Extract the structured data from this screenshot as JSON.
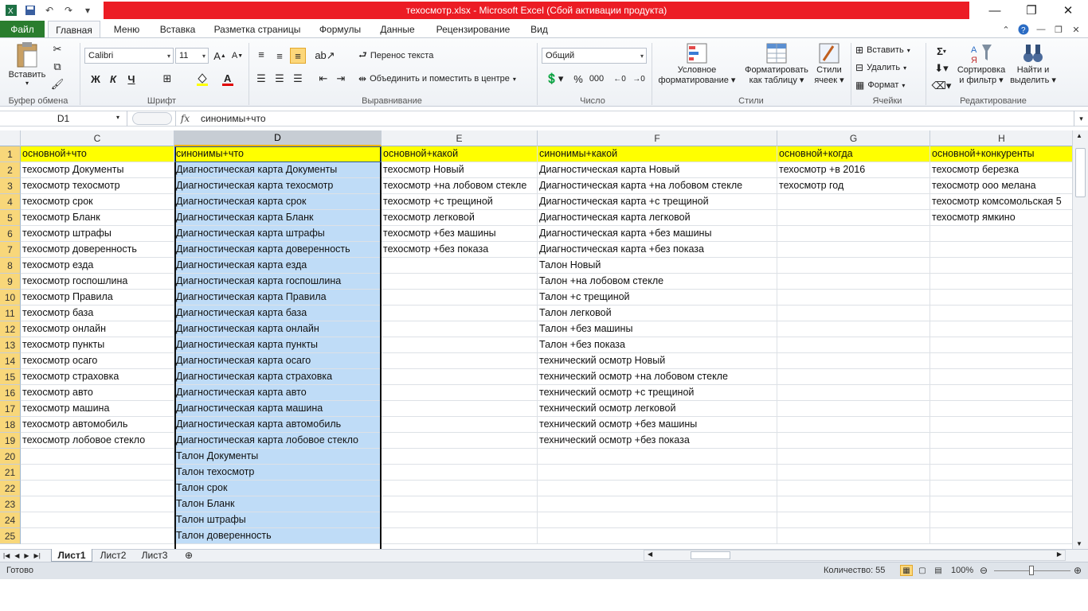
{
  "window": {
    "title": "техосмотр.xlsx  -  Microsoft Excel (Сбой активации продукта)",
    "app_icon": "excel-icon"
  },
  "tabs": {
    "file": "Файл",
    "items": [
      "Главная",
      "Меню",
      "Вставка",
      "Разметка страницы",
      "Формулы",
      "Данные",
      "Рецензирование",
      "Вид"
    ],
    "active": "Главная"
  },
  "ribbon": {
    "clipboard": {
      "paste": "Вставить",
      "label": "Буфер обмена"
    },
    "font": {
      "name": "Calibri",
      "size": "11",
      "label": "Шрифт",
      "bold": "Ж",
      "italic": "К",
      "underline": "Ч"
    },
    "alignment": {
      "wrap": "Перенос текста",
      "merge": "Объединить и поместить в центре",
      "label": "Выравнивание"
    },
    "number": {
      "format": "Общий",
      "label": "Число",
      "percent": "%",
      "thousands": "000"
    },
    "styles": {
      "conditional": "Условное",
      "conditional2": "форматирование",
      "format_table": "Форматировать",
      "format_table2": "как таблицу",
      "cell_styles": "Стили",
      "cell_styles2": "ячеек",
      "label": "Стили"
    },
    "cells": {
      "insert": "Вставить",
      "delete": "Удалить",
      "format": "Формат",
      "label": "Ячейки"
    },
    "editing": {
      "sigma": "Σ",
      "sort": "Сортировка",
      "sort2": "и фильтр",
      "find": "Найти и",
      "find2": "выделить",
      "label": "Редактирование"
    }
  },
  "formula_bar": {
    "name_box": "D1",
    "fx": "fx",
    "content": "синонимы+что"
  },
  "columns": [
    "C",
    "D",
    "E",
    "F",
    "G",
    "H"
  ],
  "selected_column": "D",
  "rows": [
    {
      "n": "1",
      "C": "основной+что",
      "D": "синонимы+что",
      "E": "основной+какой",
      "F": "синонимы+какой",
      "G": "основной+когда",
      "H": "основной+конкуренты"
    },
    {
      "n": "2",
      "C": "техосмотр Документы",
      "D": "Диагностическая карта Документы",
      "E": "техосмотр Новый",
      "F": "Диагностическая карта Новый",
      "G": "техосмотр +в 2016",
      "H": "техосмотр березка"
    },
    {
      "n": "3",
      "C": "техосмотр техосмотр",
      "D": "Диагностическая карта техосмотр",
      "E": "техосмотр +на лобовом стекле",
      "F": "Диагностическая карта +на лобовом стекле",
      "G": "техосмотр год",
      "H": "техосмотр ооо мелана"
    },
    {
      "n": "4",
      "C": "техосмотр срок",
      "D": "Диагностическая карта срок",
      "E": "техосмотр +с трещиной",
      "F": "Диагностическая карта +с трещиной",
      "G": "",
      "H": "техосмотр комсомольская 5"
    },
    {
      "n": "5",
      "C": "техосмотр Бланк",
      "D": "Диагностическая карта Бланк",
      "E": "техосмотр легковой",
      "F": "Диагностическая карта легковой",
      "G": "",
      "H": "техосмотр ямкино"
    },
    {
      "n": "6",
      "C": "техосмотр штрафы",
      "D": "Диагностическая карта штрафы",
      "E": "техосмотр +без машины",
      "F": "Диагностическая карта +без машины",
      "G": "",
      "H": ""
    },
    {
      "n": "7",
      "C": "техосмотр доверенность",
      "D": "Диагностическая карта доверенность",
      "E": "техосмотр +без показа",
      "F": "Диагностическая карта +без показа",
      "G": "",
      "H": ""
    },
    {
      "n": "8",
      "C": "техосмотр езда",
      "D": "Диагностическая карта езда",
      "E": "",
      "F": "Талон Новый",
      "G": "",
      "H": ""
    },
    {
      "n": "9",
      "C": "техосмотр госпошлина",
      "D": "Диагностическая карта госпошлина",
      "E": "",
      "F": "Талон +на лобовом стекле",
      "G": "",
      "H": ""
    },
    {
      "n": "10",
      "C": "техосмотр Правила",
      "D": "Диагностическая карта Правила",
      "E": "",
      "F": "Талон +с трещиной",
      "G": "",
      "H": ""
    },
    {
      "n": "11",
      "C": "техосмотр база",
      "D": "Диагностическая карта база",
      "E": "",
      "F": "Талон легковой",
      "G": "",
      "H": ""
    },
    {
      "n": "12",
      "C": "техосмотр онлайн",
      "D": "Диагностическая карта онлайн",
      "E": "",
      "F": "Талон +без машины",
      "G": "",
      "H": ""
    },
    {
      "n": "13",
      "C": "техосмотр пункты",
      "D": "Диагностическая карта пункты",
      "E": "",
      "F": "Талон +без показа",
      "G": "",
      "H": ""
    },
    {
      "n": "14",
      "C": "техосмотр осаго",
      "D": "Диагностическая карта осаго",
      "E": "",
      "F": "технический осмотр Новый",
      "G": "",
      "H": ""
    },
    {
      "n": "15",
      "C": "техосмотр страховка",
      "D": "Диагностическая карта страховка",
      "E": "",
      "F": "технический осмотр +на лобовом стекле",
      "G": "",
      "H": ""
    },
    {
      "n": "16",
      "C": "техосмотр авто",
      "D": "Диагностическая карта авто",
      "E": "",
      "F": "технический осмотр +с трещиной",
      "G": "",
      "H": ""
    },
    {
      "n": "17",
      "C": "техосмотр машина",
      "D": "Диагностическая карта машина",
      "E": "",
      "F": "технический осмотр легковой",
      "G": "",
      "H": ""
    },
    {
      "n": "18",
      "C": "техосмотр автомобиль",
      "D": "Диагностическая карта автомобиль",
      "E": "",
      "F": "технический осмотр +без машины",
      "G": "",
      "H": ""
    },
    {
      "n": "19",
      "C": "техосмотр лобовое стекло",
      "D": "Диагностическая карта лобовое стекло",
      "E": "",
      "F": "технический осмотр +без показа",
      "G": "",
      "H": ""
    },
    {
      "n": "20",
      "C": "",
      "D": "Талон Документы",
      "E": "",
      "F": "",
      "G": "",
      "H": ""
    },
    {
      "n": "21",
      "C": "",
      "D": "Талон техосмотр",
      "E": "",
      "F": "",
      "G": "",
      "H": ""
    },
    {
      "n": "22",
      "C": "",
      "D": "Талон срок",
      "E": "",
      "F": "",
      "G": "",
      "H": ""
    },
    {
      "n": "23",
      "C": "",
      "D": "Талон Бланк",
      "E": "",
      "F": "",
      "G": "",
      "H": ""
    },
    {
      "n": "24",
      "C": "",
      "D": "Талон штрафы",
      "E": "",
      "F": "",
      "G": "",
      "H": ""
    },
    {
      "n": "25",
      "C": "",
      "D": "Талон доверенность",
      "E": "",
      "F": "",
      "G": "",
      "H": ""
    }
  ],
  "sheets": [
    "Лист1",
    "Лист2",
    "Лист3"
  ],
  "active_sheet": "Лист1",
  "status": {
    "ready": "Готово",
    "count": "Количество: 55",
    "zoom": "100%"
  },
  "colors": {
    "header_yellow": "#ffff00",
    "selection": "#bfdcf7",
    "file_tab": "#2a7d2e",
    "title_red": "#ec1c24"
  }
}
